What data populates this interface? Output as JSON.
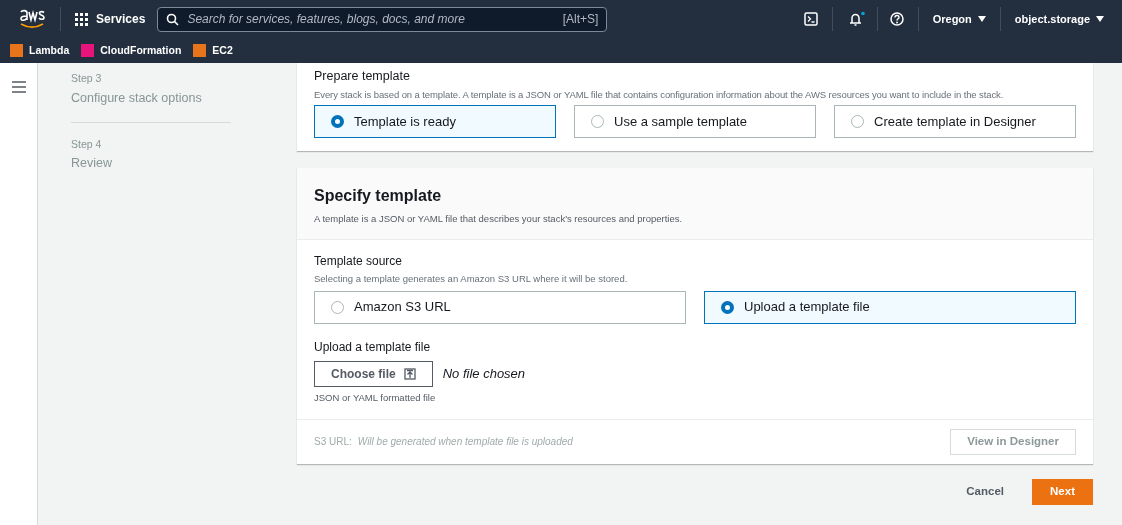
{
  "top_nav": {
    "services": "Services",
    "search": {
      "placeholder": "Search for services, features, blogs, docs, and more",
      "shortcut": "[Alt+S]"
    },
    "region": "Oregon",
    "account": "object.storage"
  },
  "favorites": [
    {
      "label": "Lambda",
      "color": "#e8741c"
    },
    {
      "label": "CloudFormation",
      "color": "#e7157b"
    },
    {
      "label": "EC2",
      "color": "#e8741c"
    }
  ],
  "sidebar": {
    "steps": [
      {
        "step": "Step 3",
        "title": "Configure stack options"
      },
      {
        "step": "Step 4",
        "title": "Review"
      }
    ]
  },
  "prepare_template": {
    "title": "Prepare template",
    "description": "Every stack is based on a template. A template is a JSON or YAML file that contains configuration information about the AWS resources you want to include in the stack.",
    "options": [
      {
        "label": "Template is ready",
        "selected": true
      },
      {
        "label": "Use a sample template",
        "selected": false
      },
      {
        "label": "Create template in Designer",
        "selected": false
      }
    ]
  },
  "specify_template": {
    "title": "Specify template",
    "description": "A template is a JSON or YAML file that describes your stack's resources and properties.",
    "source": {
      "label": "Template source",
      "description": "Selecting a template generates an Amazon S3 URL where it will be stored.",
      "options": [
        {
          "label": "Amazon S3 URL",
          "selected": false
        },
        {
          "label": "Upload a template file",
          "selected": true
        }
      ]
    },
    "upload": {
      "label": "Upload a template file",
      "button": "Choose file",
      "file_status": "No file chosen",
      "hint": "JSON or YAML formatted file"
    },
    "s3_url": {
      "label": "S3 URL:",
      "placeholder": "Will be generated when template file is uploaded",
      "disabled": true
    },
    "designer_button": {
      "label": "View in Designer",
      "disabled": true
    }
  },
  "footer": {
    "cancel": "Cancel",
    "next": "Next"
  }
}
